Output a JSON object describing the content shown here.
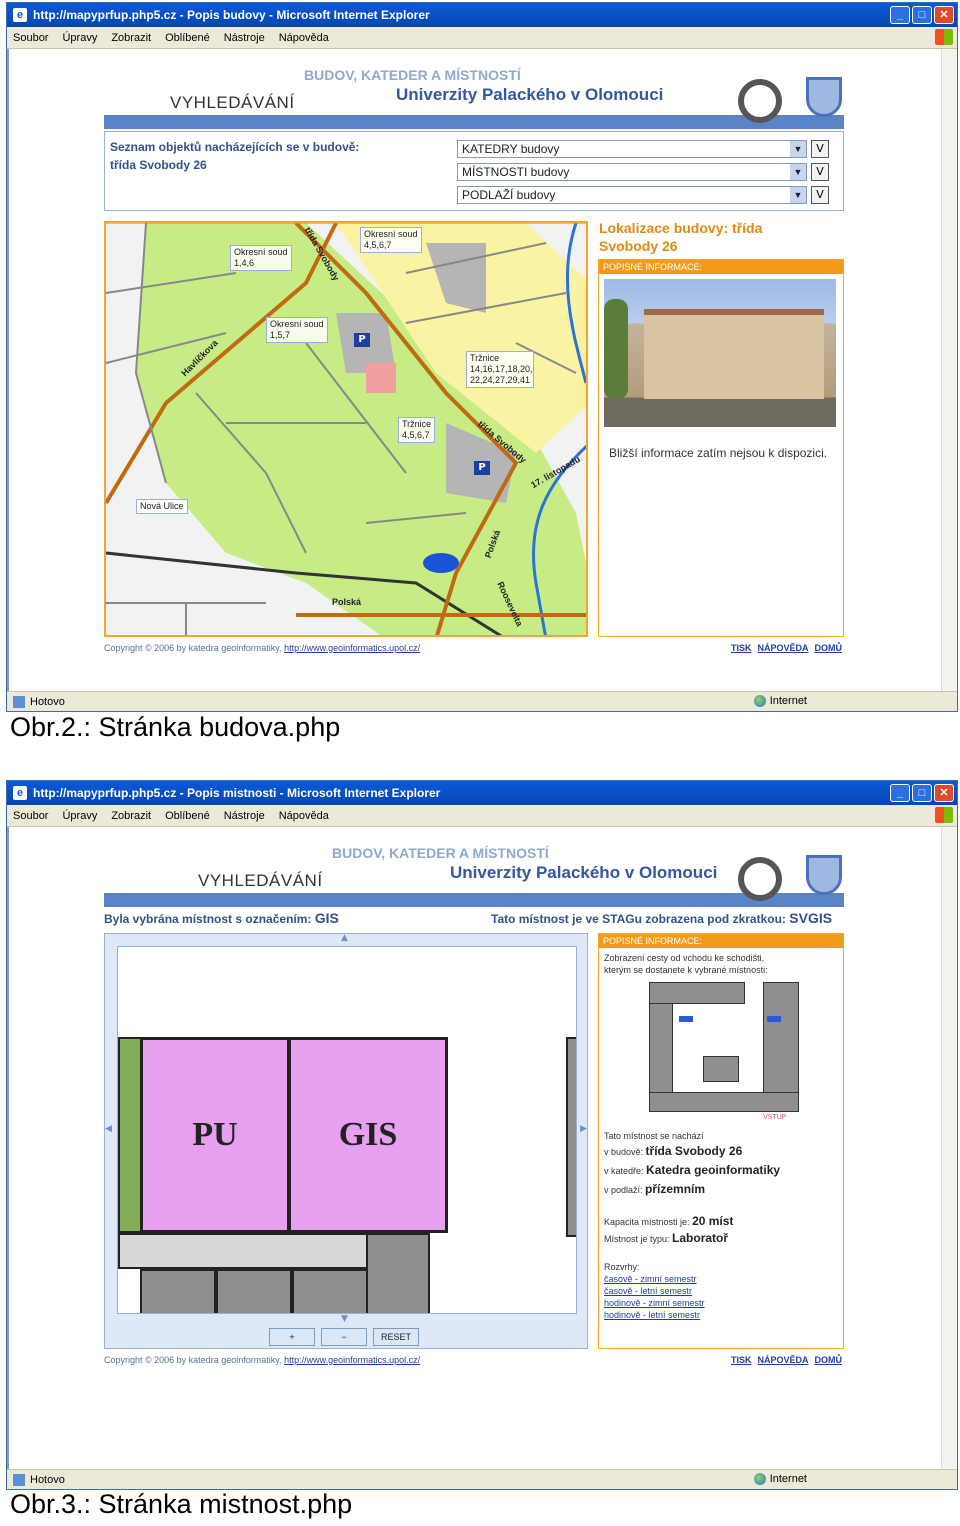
{
  "window1": {
    "title": "http://mapyprfup.php5.cz - Popis budovy - Microsoft Internet Explorer",
    "menu": [
      "Soubor",
      "Úpravy",
      "Zobrazit",
      "Oblíbené",
      "Nástroje",
      "Nápověda"
    ],
    "status": "Hotovo",
    "zone": "Internet"
  },
  "window2": {
    "title": "http://mapyprfup.php5.cz - Popis mistnosti - Microsoft Internet Explorer",
    "menu": [
      "Soubor",
      "Úpravy",
      "Zobrazit",
      "Oblíbené",
      "Nástroje",
      "Nápověda"
    ],
    "status": "Hotovo",
    "zone": "Internet"
  },
  "header": {
    "line1": "BUDOV, KATEDER A MÍSTNOSTÍ",
    "line2": "Univerzity Palackého v Olomouci",
    "line3": "VYHLEDÁVÁNÍ"
  },
  "page1": {
    "objects_label": "Seznam objektů nacházejících se v budově:",
    "building_name": "třída Svobody 26",
    "dropdowns": [
      "KATEDRY budovy",
      "MÍSTNOSTI budovy",
      "PODLAŽÍ budovy"
    ],
    "go_label": "V",
    "loc_title": "Lokalizace budovy: třída Svobody 26",
    "info_head": "POPISNÉ INFORMACE:",
    "info_text": "Bližší informace zatím nejsou k dispozici.",
    "map": {
      "labels": [
        {
          "name": "Okresní soud",
          "sub": "1,4,6"
        },
        {
          "name": "Okresní soud",
          "sub": "4,5,6,7"
        },
        {
          "name": "Okresní soud",
          "sub": "1,5,7"
        },
        {
          "name": "Tržnice",
          "sub": "14,16,17,18,20, 22,24,27,29,41"
        },
        {
          "name": "Tržnice",
          "sub": "4,5,6,7"
        },
        {
          "name": "Nová Ulice",
          "sub": ""
        }
      ],
      "streets": [
        "třída Svobody",
        "Havlíčkova",
        "třída Svobody",
        "17. listopadu",
        "Polská",
        "Polská",
        "Roosevelta"
      ],
      "parking": "P"
    }
  },
  "page2": {
    "selected_label": "Byla vybrána místnost s označením:",
    "selected_value": "GIS",
    "stag_label": "Tato místnost je ve STAGu zobrazena pod zkratkou:",
    "stag_value": "SVGIS",
    "info_head": "POPISNÉ INFORMACE:",
    "route_text": "Zobrazení cesty od vchodu ke schodišti, kterým se dostanete k vybrané místnosti:",
    "entrance": "VSTUP",
    "located": "Tato místnost se nachází",
    "rows": [
      {
        "label": "v budově:",
        "value": "třída Svobody 26"
      },
      {
        "label": "v katedře:",
        "value": "Katedra geoinformatiky"
      },
      {
        "label": "v podlaží:",
        "value": "přízemním"
      }
    ],
    "capacity_label": "Kapacita místnosti je:",
    "capacity_value": "20 míst",
    "type_label": "Místnost je typu:",
    "type_value": "Laboratoř",
    "schedules_label": "Rozvrhy:",
    "schedules": [
      "časově - zimní semestr",
      "časově - letní semestr",
      "hodinově - zimní semestr",
      "hodinově - letní semestr"
    ],
    "rooms": [
      "PU",
      "GIS"
    ],
    "zoom_in": "+",
    "zoom_out": "−",
    "reset": "RESET"
  },
  "footer": {
    "copyright": "Copyright © 2006 by katedra geoinformatiky,",
    "url": "http://www.geoinformatics.upol.cz/",
    "links": [
      "TISK",
      "NÁPOVĚDA",
      "DOMŮ"
    ]
  },
  "captions": {
    "fig2": "Obr.2.: Stránka budova.php",
    "fig3": "Obr.3.: Stránka mistnost.php"
  },
  "colors": {
    "title_bar": "#0a5ad8",
    "accent_orange": "#f39a1a",
    "header_blue": "#3456a0",
    "room_fill": "#e79ff0"
  }
}
